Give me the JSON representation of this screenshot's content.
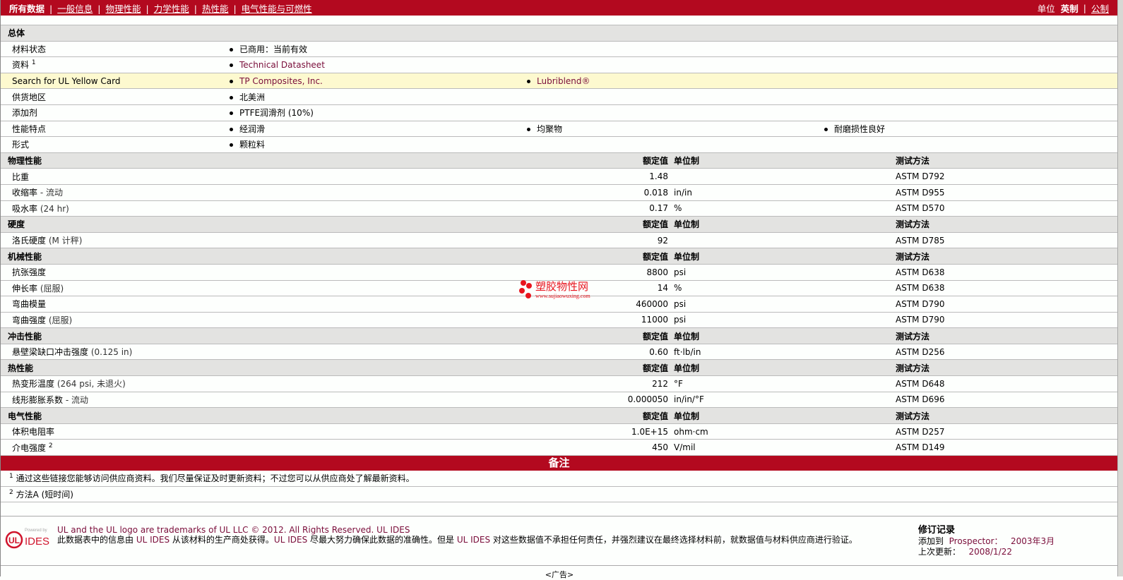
{
  "nav": {
    "items": [
      {
        "label": "所有数据",
        "active": true
      },
      {
        "label": "一般信息"
      },
      {
        "label": "物理性能"
      },
      {
        "label": "力学性能"
      },
      {
        "label": "热性能"
      },
      {
        "label": "电气性能与可燃性"
      }
    ],
    "unit_label": "单位",
    "unit_english": "英制",
    "unit_metric": "公制"
  },
  "general": {
    "title": "总体",
    "rows": [
      {
        "label": "材料状态",
        "values": [
          "已商用：当前有效"
        ]
      },
      {
        "label": "资料",
        "sup": "1",
        "values": [
          "Technical Datasheet"
        ],
        "links": true
      },
      {
        "label": "Search for UL Yellow Card",
        "values": [
          "TP Composites, Inc.",
          "Lubriblend®"
        ],
        "links": true,
        "highlight": true
      },
      {
        "label": "供货地区",
        "values": [
          "北美洲"
        ]
      },
      {
        "label": "添加剂",
        "values": [
          "PTFE润滑剂 (10%)"
        ]
      },
      {
        "label": "性能特点",
        "values": [
          "经润滑",
          "均聚物",
          "耐磨损性良好"
        ]
      },
      {
        "label": "形式",
        "values": [
          "颗粒料"
        ]
      }
    ]
  },
  "col_headers": {
    "value": "额定值",
    "unit": "单位制",
    "test": "测试方法"
  },
  "sections": [
    {
      "title": "物理性能",
      "rows": [
        {
          "label": "比重",
          "value": "1.48",
          "unit": "",
          "test": "ASTM D792"
        },
        {
          "label": "收缩率",
          "note": " - 流动",
          "value": "0.018",
          "unit": "in/in",
          "test": "ASTM D955"
        },
        {
          "label": "吸水率",
          "note": "(24 hr)",
          "value": "0.17",
          "unit": "%",
          "test": "ASTM D570"
        }
      ]
    },
    {
      "title": "硬度",
      "rows": [
        {
          "label": "洛氏硬度",
          "note": "(M 计秤)",
          "value": "92",
          "unit": "",
          "test": "ASTM D785"
        }
      ]
    },
    {
      "title": "机械性能",
      "rows": [
        {
          "label": "抗张强度",
          "value": "8800",
          "unit": "psi",
          "test": "ASTM D638"
        },
        {
          "label": "伸长率",
          "note": "(屈服)",
          "value": "14",
          "unit": "%",
          "test": "ASTM D638"
        },
        {
          "label": "弯曲模量",
          "value": "460000",
          "unit": "psi",
          "test": "ASTM D790"
        },
        {
          "label": "弯曲强度",
          "note": "(屈服)",
          "value": "11000",
          "unit": "psi",
          "test": "ASTM D790"
        }
      ]
    },
    {
      "title": "冲击性能",
      "rows": [
        {
          "label": "悬壁梁缺口冲击强度",
          "note": "(0.125 in)",
          "value": "0.60",
          "unit": "ft·lb/in",
          "test": "ASTM D256"
        }
      ]
    },
    {
      "title": "热性能",
      "rows": [
        {
          "label": "热变形温度",
          "note": "(264 psi, 未退火)",
          "value": "212",
          "unit": "°F",
          "test": "ASTM D648"
        },
        {
          "label": "线形膨胀系数",
          "note": " - 流动",
          "value": "0.000050",
          "unit": "in/in/°F",
          "test": "ASTM D696"
        }
      ]
    },
    {
      "title": "电气性能",
      "rows": [
        {
          "label": "体积电阻率",
          "value": "1.0E+15",
          "unit": "ohm·cm",
          "test": "ASTM D257"
        },
        {
          "label": "介电强度",
          "sup": "2",
          "value": "450",
          "unit": "V/mil",
          "test": "ASTM D149"
        }
      ]
    }
  ],
  "notes": {
    "title": "备注",
    "items": [
      {
        "sup": "1",
        "text": "通过这些链接您能够访问供应商资料。我们尽量保证及时更新资料；不过您可以从供应商处了解最新资料。"
      },
      {
        "sup": "2",
        "text": "方法A (短时间)"
      }
    ]
  },
  "footer": {
    "logo_powered": "Powered by",
    "logo_ul": "UL",
    "logo_ides": "IDES",
    "legal_line1": "UL and the UL logo are trademarks of UL LLC © 2012. All Rights Reserved. UL IDES",
    "legal_p1": "此数据表中的信息由 ",
    "legal_l1": "UL IDES",
    "legal_p2": " 从该材料的生产商处获得。",
    "legal_l2": "UL IDES",
    "legal_p3": " 尽最大努力确保此数据的准确性。但是 ",
    "legal_l3": "UL IDES",
    "legal_p4": " 对这些数据值不承担任何责任，并强烈建议在最终选择材料前，就数据值与材料供应商进行验证。",
    "rev_title": "修订记录",
    "added_label": "添加到",
    "added_link": "Prospector：",
    "added_date": "2003年3月",
    "updated_label": "上次更新：",
    "updated_date": "2008/1/22"
  },
  "ad": "<广告>",
  "watermark": {
    "name": "塑胶物性网",
    "url": "www.sujiaowuxing.com"
  },
  "colors": {
    "brand": "#b3091f",
    "link": "#7a0d3a",
    "highlight": "#fdf9cf",
    "header": "#e3e3e1"
  }
}
